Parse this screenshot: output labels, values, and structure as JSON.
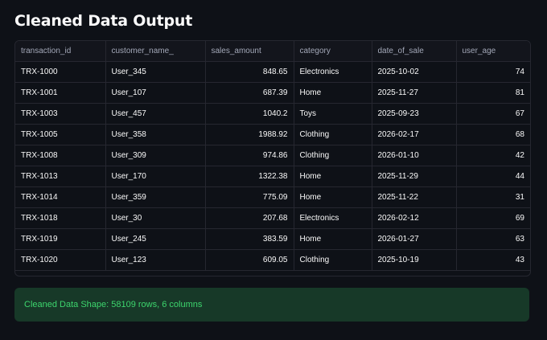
{
  "page": {
    "title": "Cleaned Data Output"
  },
  "table": {
    "columns": [
      "transaction_id",
      "customer_name_",
      "sales_amount",
      "category",
      "date_of_sale",
      "user_age"
    ],
    "rows": [
      [
        "TRX-1000",
        "User_345",
        "848.65",
        "Electronics",
        "2025-10-02",
        "74"
      ],
      [
        "TRX-1001",
        "User_107",
        "687.39",
        "Home",
        "2025-11-27",
        "81"
      ],
      [
        "TRX-1003",
        "User_457",
        "1040.2",
        "Toys",
        "2025-09-23",
        "67"
      ],
      [
        "TRX-1005",
        "User_358",
        "1988.92",
        "Clothing",
        "2026-02-17",
        "68"
      ],
      [
        "TRX-1008",
        "User_309",
        "974.86",
        "Clothing",
        "2026-01-10",
        "42"
      ],
      [
        "TRX-1013",
        "User_170",
        "1322.38",
        "Home",
        "2025-11-29",
        "44"
      ],
      [
        "TRX-1014",
        "User_359",
        "775.09",
        "Home",
        "2025-11-22",
        "31"
      ],
      [
        "TRX-1018",
        "User_30",
        "207.68",
        "Electronics",
        "2026-02-12",
        "69"
      ],
      [
        "TRX-1019",
        "User_245",
        "383.59",
        "Home",
        "2026-01-27",
        "63"
      ],
      [
        "TRX-1020",
        "User_123",
        "609.05",
        "Clothing",
        "2025-10-19",
        "43"
      ]
    ]
  },
  "status": {
    "message": "Cleaned Data Shape: 58109 rows, 6 columns"
  },
  "colors": {
    "background": "#0e1117",
    "success_bg": "#173928",
    "success_text": "#3dd56d"
  }
}
